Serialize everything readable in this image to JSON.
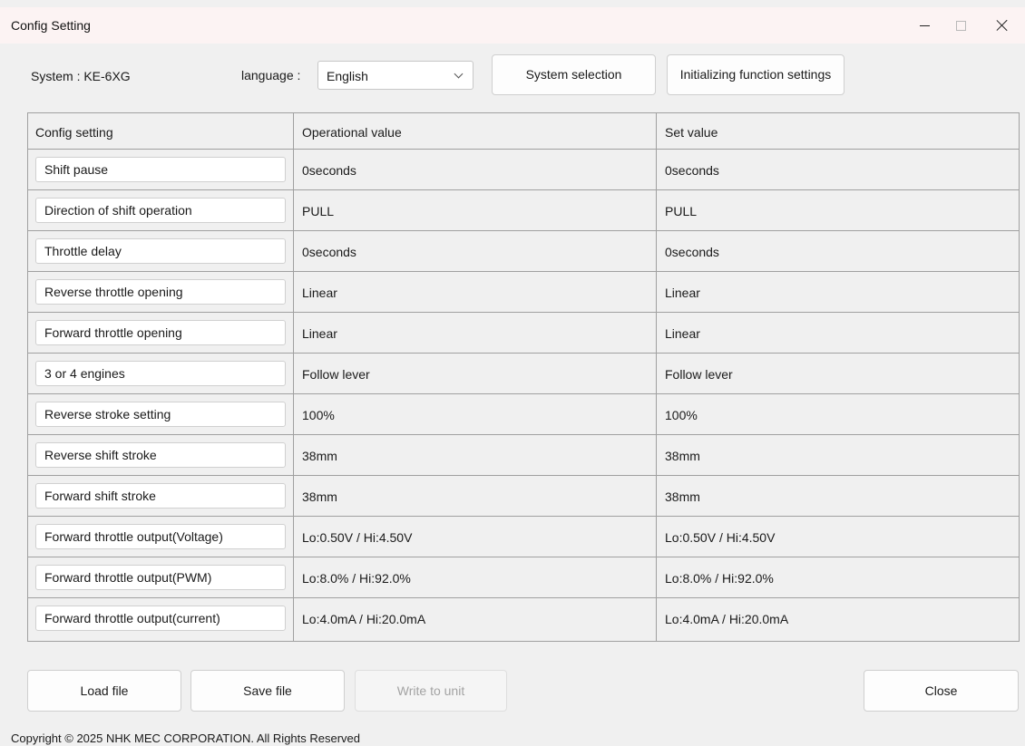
{
  "window": {
    "title": "Config Setting"
  },
  "top": {
    "system_label": "System : KE-6XG",
    "language_label": "language :",
    "language_value": "English",
    "system_selection_button": "System selection",
    "init_function_button": "Initializing function settings"
  },
  "table": {
    "headers": [
      "Config setting",
      "Operational value",
      "Set value"
    ],
    "rows": [
      {
        "setting": "Shift pause",
        "operational": "0seconds",
        "set": "0seconds"
      },
      {
        "setting": "Direction of shift operation",
        "operational": "PULL",
        "set": "PULL"
      },
      {
        "setting": "Throttle delay",
        "operational": "0seconds",
        "set": "0seconds"
      },
      {
        "setting": "Reverse throttle opening",
        "operational": "Linear",
        "set": "Linear"
      },
      {
        "setting": "Forward throttle opening",
        "operational": "Linear",
        "set": "Linear"
      },
      {
        "setting": "3 or 4 engines",
        "operational": "Follow lever",
        "set": "Follow lever"
      },
      {
        "setting": "Reverse stroke setting",
        "operational": "100%",
        "set": "100%"
      },
      {
        "setting": "Reverse shift stroke",
        "operational": "38mm",
        "set": "38mm"
      },
      {
        "setting": "Forward shift stroke",
        "operational": "38mm",
        "set": "38mm"
      },
      {
        "setting": "Forward throttle output(Voltage)",
        "operational": "Lo:0.50V / Hi:4.50V",
        "set": "Lo:0.50V / Hi:4.50V"
      },
      {
        "setting": "Forward throttle output(PWM)",
        "operational": "Lo:8.0% / Hi:92.0%",
        "set": "Lo:8.0% / Hi:92.0%"
      },
      {
        "setting": "Forward throttle output(current)",
        "operational": "Lo:4.0mA / Hi:20.0mA",
        "set": "Lo:4.0mA / Hi:20.0mA"
      }
    ]
  },
  "bottom": {
    "load_file": "Load file",
    "save_file": "Save file",
    "write_to_unit": "Write to unit",
    "close": "Close"
  },
  "footer": {
    "copyright": "Copyright © 2025 NHK MEC CORPORATION. All Rights Reserved"
  },
  "colors": {
    "titlebar_bg": "#fcf3f3",
    "window_bg": "#f0f0f0",
    "grid_line": "#a0a0a0",
    "disabled_text": "#a3a3a3"
  }
}
